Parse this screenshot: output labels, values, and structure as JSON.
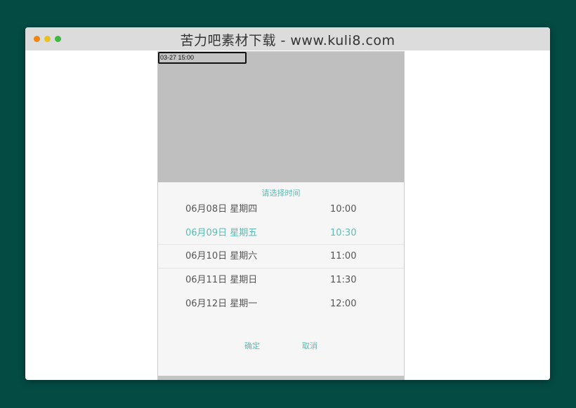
{
  "window": {
    "title": "苦力吧素材下载 - www.kuli8.com"
  },
  "date_field": {
    "value": "03-27 15:00"
  },
  "picker": {
    "title": "请选择时间",
    "rows": [
      {
        "date": "06月08日 星期四",
        "time": "10:00"
      },
      {
        "date": "06月09日 星期五",
        "time": "10:30"
      },
      {
        "date": "06月10日 星期六",
        "time": "11:00"
      },
      {
        "date": "06月11日 星期日",
        "time": "11:30"
      },
      {
        "date": "06月12日 星期一",
        "time": "12:00"
      }
    ],
    "confirm_label": "确定",
    "cancel_label": "取消"
  },
  "colors": {
    "accent": "#5bbcb4",
    "background": "#044b44"
  }
}
